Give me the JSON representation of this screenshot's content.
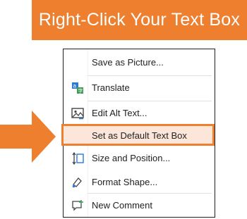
{
  "banner": {
    "title": "Right-Click Your Text Box"
  },
  "menu": {
    "items": [
      {
        "label": "Save as Picture...",
        "icon": ""
      },
      {
        "label": "Translate",
        "icon": "translate-icon"
      },
      {
        "label": "Edit Alt Text...",
        "icon": "alt-text-icon"
      },
      {
        "label": "Set as Default Text Box",
        "icon": ""
      },
      {
        "label": "Size and Position...",
        "icon": "size-position-icon"
      },
      {
        "label": "Format Shape...",
        "icon": "format-shape-icon"
      },
      {
        "label": "New Comment",
        "icon": "new-comment-icon"
      }
    ]
  },
  "colors": {
    "accent": "#ee7f2f",
    "highlight_fill": "#fbe6d9"
  }
}
